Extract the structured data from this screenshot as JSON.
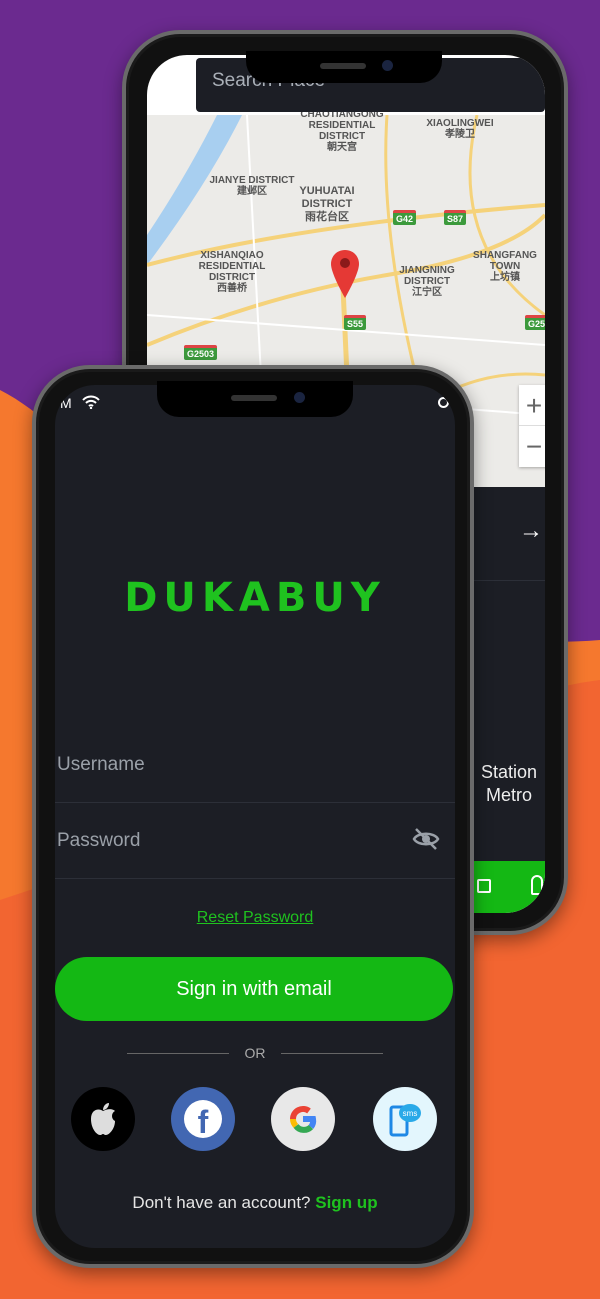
{
  "colors": {
    "purple": "#6B2A8F",
    "orange": "#F5782E",
    "orange_dark": "#F26531",
    "accent": "#14B814",
    "screen_bg": "#1C1E25"
  },
  "back_phone": {
    "search_placeholder": "Search Place",
    "map": {
      "labels": [
        {
          "en": "CHAOTIANGONG RESIDENTIAL DISTRICT",
          "cn": "朝天宫"
        },
        {
          "en": "XIAOLINGWEI",
          "cn": "孝陵卫"
        },
        {
          "en": "JIANYE DISTRICT",
          "cn": "建邺区"
        },
        {
          "en": "YUHUATAI DISTRICT",
          "cn": "雨花台区"
        },
        {
          "en": "XISHANQIAO RESIDENTIAL DISTRICT",
          "cn": "西善桥"
        },
        {
          "en": "JIANGNING DISTRICT",
          "cn": "江宁区"
        },
        {
          "en": "SHANGFANG TOWN",
          "cn": "上坊镇"
        }
      ],
      "shields": [
        "G42",
        "S87",
        "S55",
        "G2503",
        "G25"
      ],
      "zoom_in": "+",
      "zoom_out": "−",
      "marker_icon": "map-pin-icon"
    },
    "arrow_icon": "arrow-right-icon",
    "station_text": [
      "Station",
      "Metro"
    ],
    "nav_icons": [
      "bag-icon",
      "user-icon"
    ]
  },
  "front_phone": {
    "status_time": "M",
    "logo": "DUKABUY",
    "username_placeholder": "Username",
    "password_placeholder": "Password",
    "reset_password": "Reset Password",
    "sign_in_button": "Sign in with email",
    "or_label": "OR",
    "social": [
      {
        "name": "apple",
        "icon": "apple-icon",
        "bg": "#000000"
      },
      {
        "name": "facebook",
        "icon": "facebook-icon",
        "bg": "#4267B2"
      },
      {
        "name": "google",
        "icon": "google-icon",
        "bg": "#E8E8E8"
      },
      {
        "name": "sms",
        "icon": "sms-icon",
        "bg": "#E3F6FD"
      }
    ],
    "signup_prompt": "Don't have an account?",
    "signup_link": "Sign up"
  }
}
